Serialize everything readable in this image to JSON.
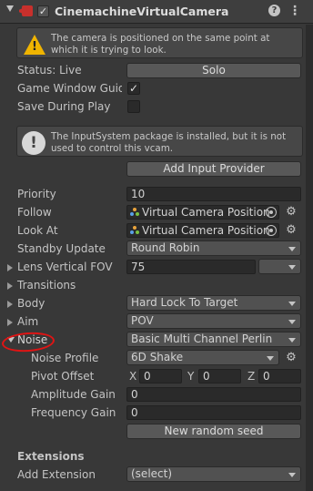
{
  "component": {
    "title": "CinemachineVirtualCamera"
  },
  "warning": {
    "text": "The camera is positioned on the same point at which it is trying to look."
  },
  "status": {
    "label": "Status: Live",
    "solo_button": "Solo"
  },
  "game_window_guides": {
    "label": "Game Window Guides",
    "checked": true
  },
  "save_during_play": {
    "label": "Save During Play",
    "checked": false
  },
  "input_info": {
    "text": "The InputSystem package is installed, but it is not used to control this vcam.",
    "button": "Add Input Provider"
  },
  "priority": {
    "label": "Priority",
    "value": "10"
  },
  "follow": {
    "label": "Follow",
    "value": "Virtual Camera Position"
  },
  "look_at": {
    "label": "Look At",
    "value": "Virtual Camera Position"
  },
  "standby_update": {
    "label": "Standby Update",
    "value": "Round Robin"
  },
  "lens_fov": {
    "label": "Lens Vertical FOV",
    "value": "75"
  },
  "transitions": {
    "label": "Transitions"
  },
  "body": {
    "label": "Body",
    "value": "Hard Lock To Target"
  },
  "aim": {
    "label": "Aim",
    "value": "POV"
  },
  "noise": {
    "label": "Noise",
    "value": "Basic Multi Channel Perlin",
    "profile_label": "Noise Profile",
    "profile_value": "6D Shake",
    "pivot_label": "Pivot Offset",
    "pivot": {
      "x_label": "X",
      "x": "0",
      "y_label": "Y",
      "y": "0",
      "z_label": "Z",
      "z": "0"
    },
    "amplitude_label": "Amplitude Gain",
    "amplitude": "0",
    "frequency_label": "Frequency Gain",
    "frequency": "0",
    "seed_button": "New random seed"
  },
  "extensions": {
    "header": "Extensions",
    "add_label": "Add Extension",
    "add_value": "(select)"
  },
  "icons": {
    "header_fold": "chevron-down-icon",
    "component": "cinemachine-camera-icon",
    "help": "help-icon",
    "menu": "kebab-menu-icon",
    "warning": "warning-icon",
    "info": "info-icon",
    "target": "object-picker-icon",
    "settings": "gear-icon"
  },
  "colors": {
    "annotation_circle": "#e01414",
    "warning": "#f0b400",
    "component_icon": "#c8302c"
  }
}
